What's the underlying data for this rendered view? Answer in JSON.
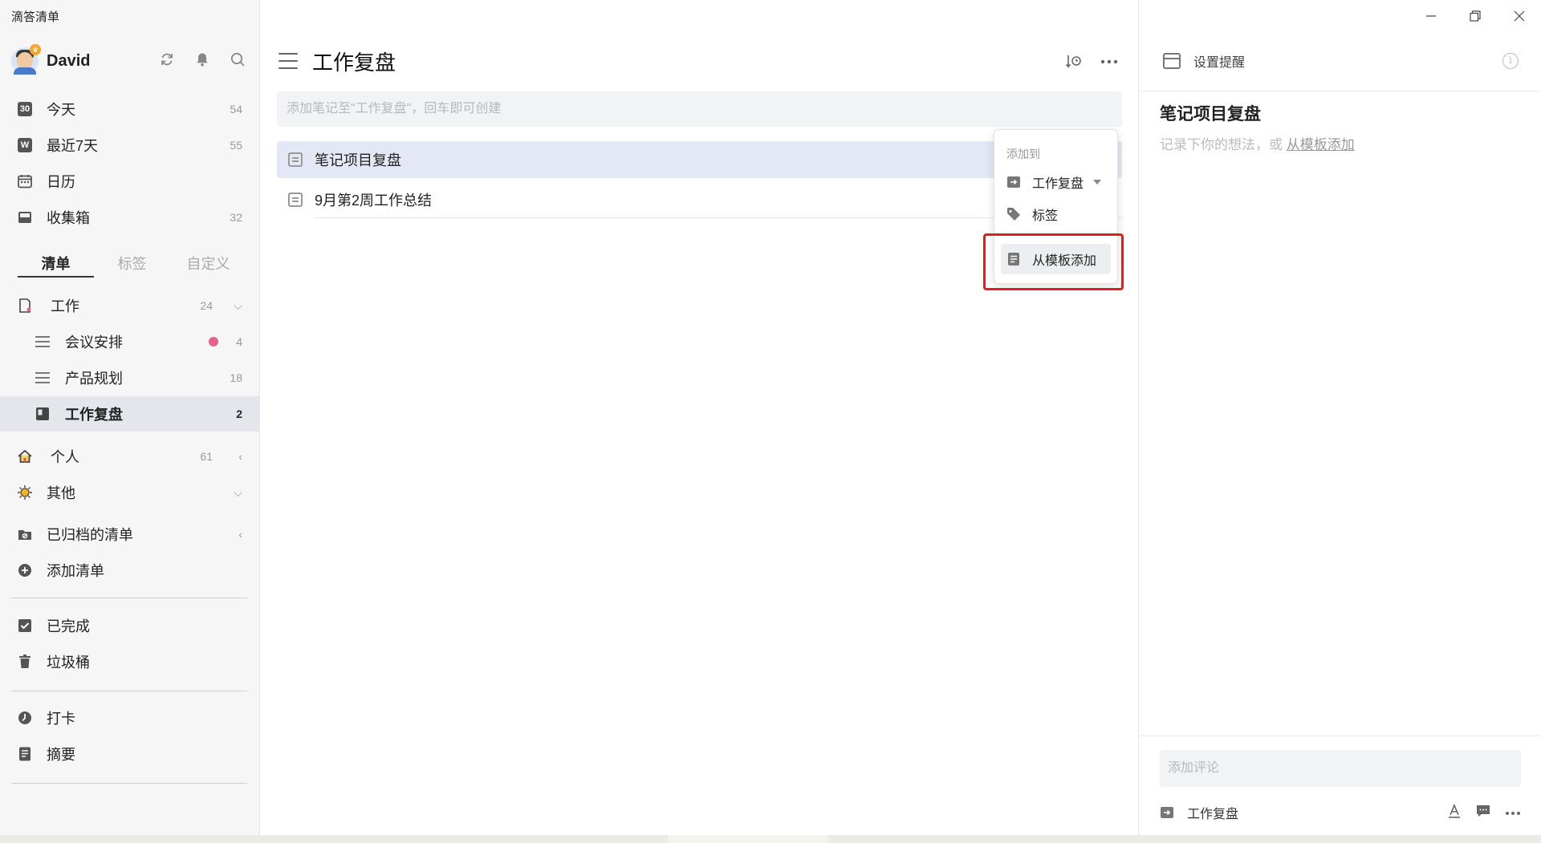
{
  "app": {
    "title": "滴答清单"
  },
  "user": {
    "name": "David"
  },
  "sidebar": {
    "top_icons": [
      "sync-icon",
      "bell-icon",
      "search-icon"
    ],
    "smart_lists": [
      {
        "label": "今天",
        "count": "54",
        "icon_text": "30"
      },
      {
        "label": "最近7天",
        "count": "55",
        "icon_text": "W"
      },
      {
        "label": "日历",
        "count": ""
      },
      {
        "label": "收集箱",
        "count": "32"
      }
    ],
    "tabs": [
      "清单",
      "标签",
      "自定义"
    ],
    "folders": [
      {
        "label": "工作",
        "count": "24"
      },
      {
        "label": "会议安排",
        "count": "4",
        "dot_color": "#e8608e"
      },
      {
        "label": "产品规划",
        "count": "18"
      },
      {
        "label": "工作复盘",
        "count": "2"
      },
      {
        "label": "个人",
        "count": "61"
      },
      {
        "label": "其他",
        "count": ""
      },
      {
        "label": "已归档的清单",
        "count": ""
      },
      {
        "label": "添加清单",
        "count": ""
      }
    ],
    "bottom": [
      {
        "label": "已完成"
      },
      {
        "label": "垃圾桶"
      },
      {
        "label": "打卡"
      },
      {
        "label": "摘要"
      }
    ]
  },
  "main": {
    "title": "工作复盘",
    "add_placeholder": "添加笔记至\"工作复盘\"，回车即可创建",
    "notes": [
      {
        "title": "笔记项目复盘",
        "selected": true
      },
      {
        "title": "9月第2周工作总结",
        "selected": false
      }
    ]
  },
  "popup": {
    "title": "添加到",
    "list_name": "工作复盘",
    "tag_label": "标签",
    "template_label": "从模板添加"
  },
  "detail": {
    "reminder": "设置提醒",
    "title": "笔记项目复盘",
    "placeholder_prefix": "记录下你的想法，或 ",
    "placeholder_link": "从模板添加",
    "comment_placeholder": "添加评论",
    "list_name": "工作复盘"
  },
  "colors": {
    "accent_highlight": "#e02020",
    "sidebar_bg": "#f6f6f6",
    "selected_bg": "#e4e8f4"
  }
}
